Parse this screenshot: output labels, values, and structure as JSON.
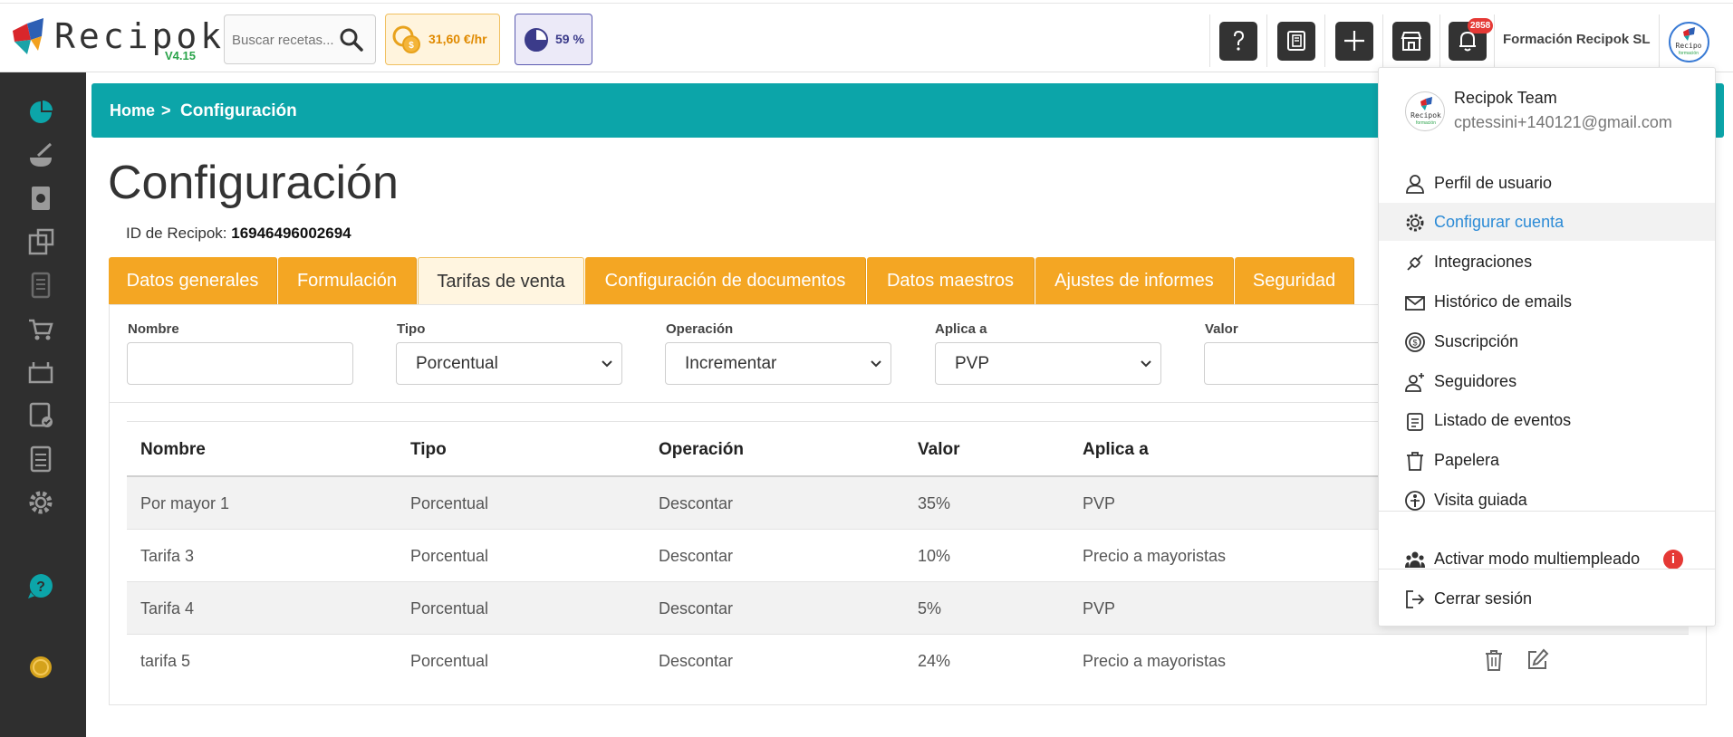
{
  "app": {
    "name": "Recipok",
    "version": "V4.15"
  },
  "header": {
    "search_placeholder": "Buscar recetas...",
    "cost_badge": "31,60 €/hr",
    "percent_badge": "59 %",
    "notifications_count": "2858",
    "company": "Formación Recipok SL",
    "icons": [
      "help-icon",
      "document-icon",
      "plus-icon",
      "store-icon",
      "bell-icon"
    ]
  },
  "sidebar": {
    "items": [
      "dashboard-icon",
      "recipe-icon",
      "notebook-icon",
      "inventory-icon",
      "list-icon",
      "shopping-cart-icon",
      "delivery-icon",
      "report-icon",
      "checklist-icon",
      "settings-icon",
      "help-icon",
      "coin-icon"
    ]
  },
  "breadcrumb": {
    "home": "Home",
    "separator": ">",
    "current": "Configuración"
  },
  "page": {
    "title": "Configuración",
    "id_label": "ID de Recipok:",
    "id_value": "16946496002694"
  },
  "tabs": [
    {
      "label": "Datos generales"
    },
    {
      "label": "Formulación"
    },
    {
      "label": "Tarifas de venta",
      "active": true
    },
    {
      "label": "Configuración de documentos"
    },
    {
      "label": "Datos maestros"
    },
    {
      "label": "Ajustes de informes"
    },
    {
      "label": "Seguridad"
    }
  ],
  "form": {
    "nombre_label": "Nombre",
    "nombre_value": "",
    "tipo_label": "Tipo",
    "tipo_value": "Porcentual",
    "operacion_label": "Operación",
    "operacion_value": "Incrementar",
    "aplica_label": "Aplica a",
    "aplica_value": "PVP",
    "valor_label": "Valor",
    "valor_value": ""
  },
  "table": {
    "headers": [
      "Nombre",
      "Tipo",
      "Operación",
      "Valor",
      "Aplica a"
    ],
    "rows": [
      [
        "Por mayor 1",
        "Porcentual",
        "Descontar",
        "35%",
        "PVP"
      ],
      [
        "Tarifa 3",
        "Porcentual",
        "Descontar",
        "10%",
        "Precio a mayoristas"
      ],
      [
        "Tarifa 4",
        "Porcentual",
        "Descontar",
        "5%",
        "PVP"
      ],
      [
        "tarifa 5",
        "Porcentual",
        "Descontar",
        "24%",
        "Precio a mayoristas"
      ]
    ]
  },
  "user_menu": {
    "name": "Recipok Team",
    "email": "cptessini+140121@gmail.com",
    "items": [
      {
        "label": "Perfil de usuario",
        "icon": "user-icon"
      },
      {
        "label": "Configurar cuenta",
        "icon": "gear-icon",
        "highlighted": true
      },
      {
        "label": "Integraciones",
        "icon": "integrations-icon"
      },
      {
        "label": "Histórico de emails",
        "icon": "mail-icon"
      },
      {
        "label": "Suscripción",
        "icon": "subscription-icon"
      },
      {
        "label": "Seguidores",
        "icon": "followers-icon"
      },
      {
        "label": "Listado de eventos",
        "icon": "events-icon"
      },
      {
        "label": "Papelera",
        "icon": "trash-icon"
      },
      {
        "label": "Visita guiada",
        "icon": "guide-icon"
      }
    ],
    "multiemployee": "Activar modo multiempleado",
    "logout": "Cerrar sesión"
  },
  "colors": {
    "teal": "#0ca5a9",
    "orange": "#f4a623",
    "sidebar": "#2f2f2f",
    "link_blue": "#2c8bd6"
  }
}
